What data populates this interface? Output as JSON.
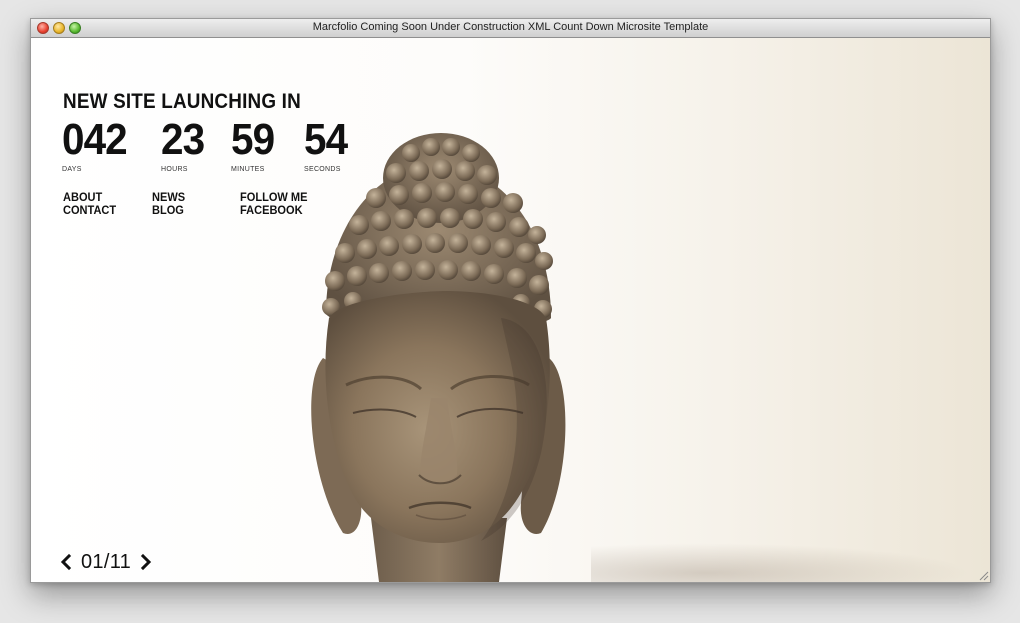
{
  "window": {
    "title": "Marcfolio Coming Soon Under Construction XML Count Down Microsite Template"
  },
  "hero": {
    "headline": "NEW SITE LAUNCHING IN"
  },
  "countdown": {
    "days": {
      "value": "042",
      "label": "DAYS"
    },
    "hours": {
      "value": "23",
      "label": "HOURS"
    },
    "minutes": {
      "value": "59",
      "label": "MINUTES"
    },
    "seconds": {
      "value": "54",
      "label": "SECONDS"
    }
  },
  "nav": {
    "about": "ABOUT",
    "contact": "CONTACT",
    "news": "NEWS",
    "blog": "BLOG",
    "follow_me": "FOLLOW ME",
    "facebook": "FACEBOOK"
  },
  "pager": {
    "current": "01/11",
    "prev_icon": "chevron-left-icon",
    "next_icon": "chevron-right-icon"
  },
  "colors": {
    "text": "#111111",
    "background_warm": "#ece5d6"
  },
  "image": {
    "subject": "stone buddha head"
  }
}
